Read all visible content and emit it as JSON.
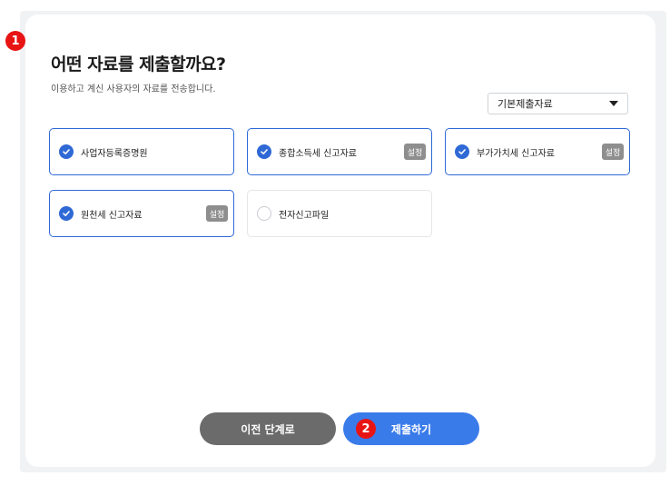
{
  "markers": {
    "one": "1",
    "two": "2"
  },
  "header": {
    "title": "어떤 자료를 제출할까요?",
    "subtitle": "이용하고 계신 사용자의 자료를 전송합니다."
  },
  "filter": {
    "selected": "기본제출자료"
  },
  "options": [
    {
      "label": "사업자등록증명원",
      "checked": true,
      "has_setting": false
    },
    {
      "label": "종합소득세 신고자료",
      "checked": true,
      "has_setting": true
    },
    {
      "label": "부가가치세 신고자료",
      "checked": true,
      "has_setting": true
    },
    {
      "label": "원천세 신고자료",
      "checked": true,
      "has_setting": true
    },
    {
      "label": "전자신고파일",
      "checked": false,
      "has_setting": false
    }
  ],
  "setting_label": "설정",
  "actions": {
    "prev_label": "이전 단계로",
    "submit_label": "제출하기"
  },
  "colors": {
    "accent": "#2f69d6",
    "submit": "#3a7bea",
    "prev": "#6b6b6b",
    "marker": "#e81414"
  },
  "icons": {
    "check": "check-icon",
    "caret": "caret-down-icon"
  }
}
